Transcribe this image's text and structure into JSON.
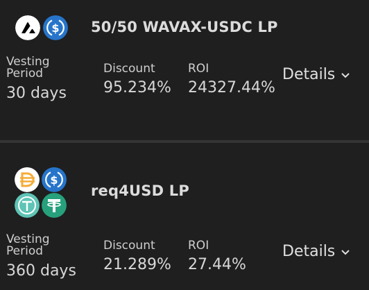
{
  "bonds": [
    {
      "name": "50/50 WAVAX-USDC LP",
      "icons": [
        "avax-icon",
        "usdc-icon"
      ],
      "vesting_label_line1": "Vesting",
      "vesting_label_line2": "Period",
      "vesting_value": "30 days",
      "discount_label": "Discount",
      "discount_value": "95.234%",
      "roi_label": "ROI",
      "roi_value": "24327.44%",
      "details_label": "Details"
    },
    {
      "name": "req4USD LP",
      "icons": [
        "dai-icon",
        "usdc-icon",
        "tusd-icon",
        "usdt-icon"
      ],
      "vesting_label_line1": "Vesting",
      "vesting_label_line2": "Period",
      "vesting_value": "360 days",
      "discount_label": "Discount",
      "discount_value": "21.289%",
      "roi_label": "ROI",
      "roi_value": "27.44%",
      "details_label": "Details"
    }
  ],
  "colors": {
    "background": "#1f1f1f",
    "divider": "#343434",
    "usdc": "#2775ca",
    "dai": "#f5ac37",
    "tusd": "#5ec4b6",
    "usdt": "#26a17b"
  }
}
